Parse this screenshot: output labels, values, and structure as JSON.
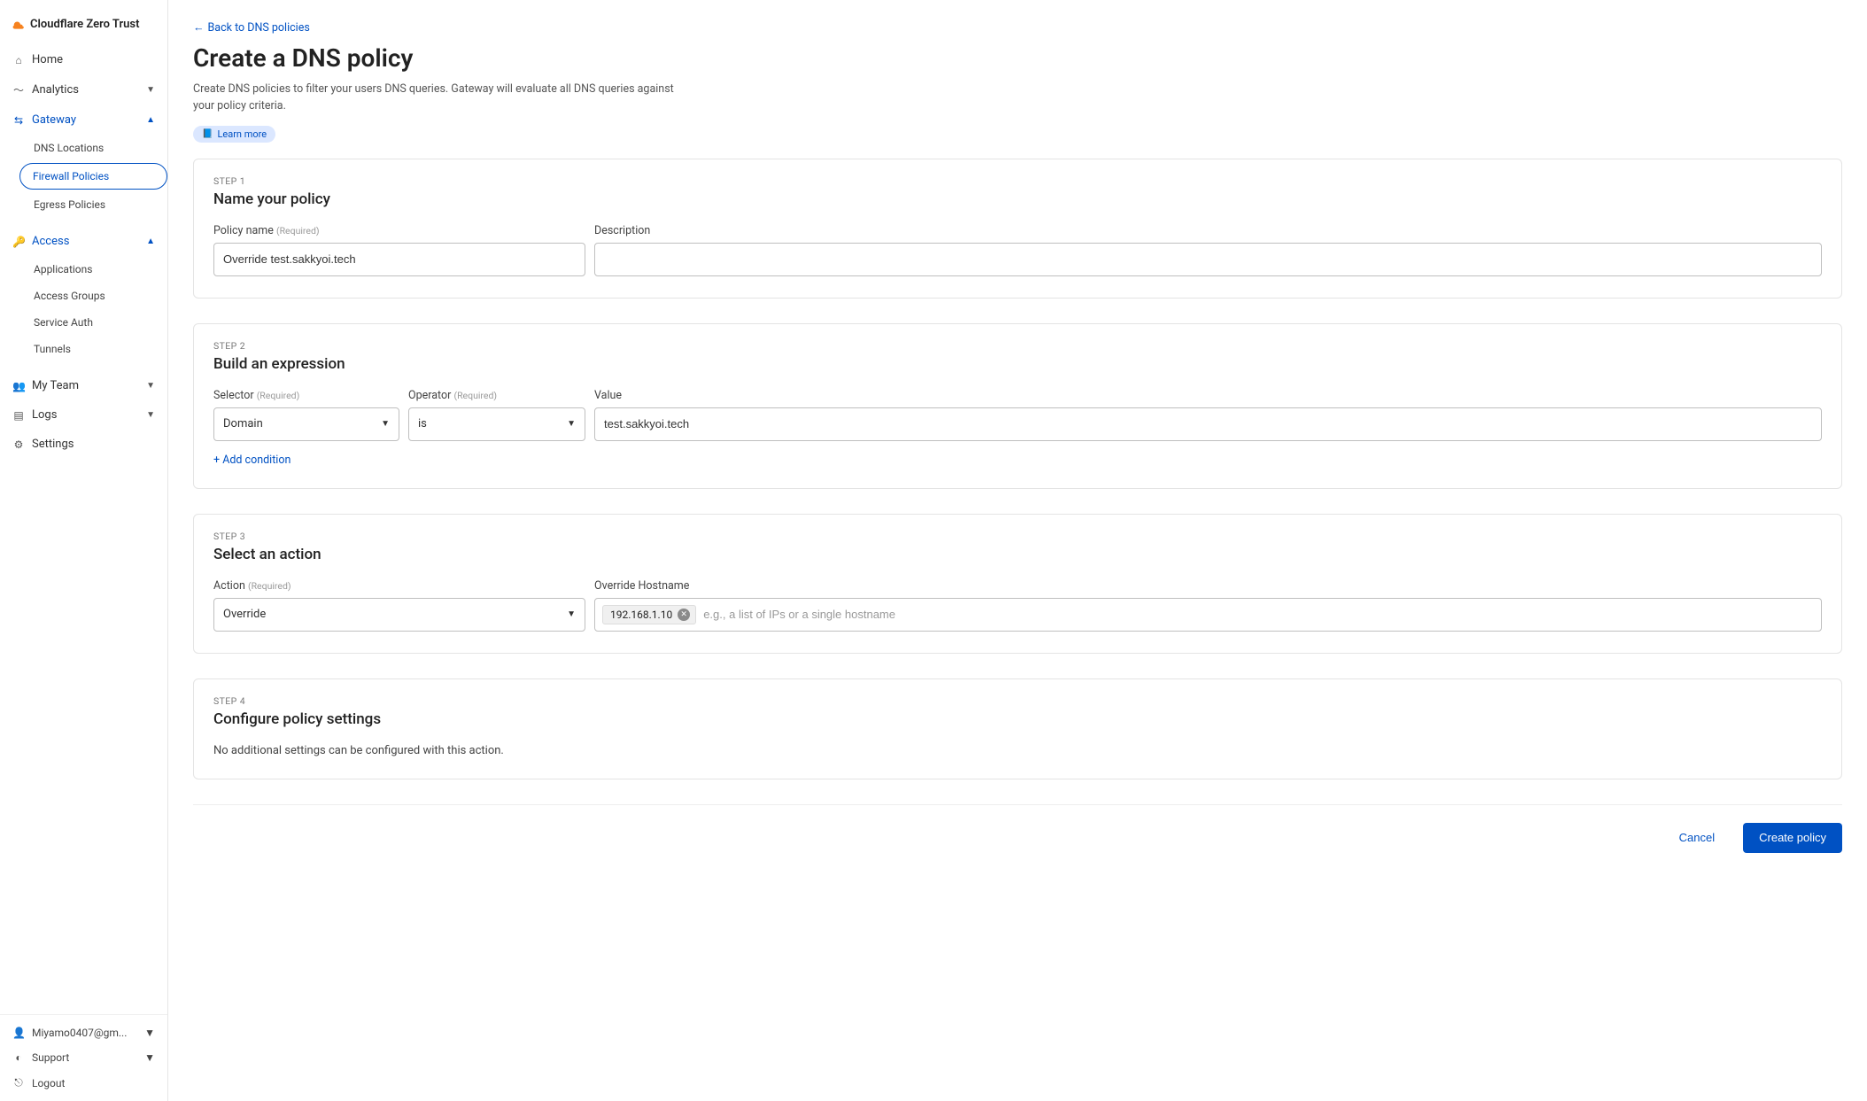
{
  "brand": {
    "title": "Cloudflare Zero Trust"
  },
  "sidebar": {
    "home": "Home",
    "analytics": "Analytics",
    "gateway": {
      "label": "Gateway",
      "dns_locations": "DNS Locations",
      "firewall_policies": "Firewall Policies",
      "egress_policies": "Egress Policies"
    },
    "access": {
      "label": "Access",
      "applications": "Applications",
      "access_groups": "Access Groups",
      "service_auth": "Service Auth",
      "tunnels": "Tunnels"
    },
    "my_team": "My Team",
    "logs": "Logs",
    "settings": "Settings"
  },
  "footer": {
    "account": "Miyamo0407@gm...",
    "support": "Support",
    "logout": "Logout"
  },
  "header": {
    "back_link": "Back to DNS policies",
    "title": "Create a DNS policy",
    "description": "Create DNS policies to filter your users DNS queries. Gateway will evaluate all DNS queries against your policy criteria.",
    "learn_more": "Learn more"
  },
  "step1": {
    "step_label": "STEP 1",
    "title": "Name your policy",
    "policy_name_label": "Policy name",
    "required": "(Required)",
    "policy_name_value": "Override test.sakkyoi.tech",
    "description_label": "Description",
    "description_value": ""
  },
  "step2": {
    "step_label": "STEP 2",
    "title": "Build an expression",
    "selector_label": "Selector",
    "operator_label": "Operator",
    "value_label": "Value",
    "required": "(Required)",
    "selector_value": "Domain",
    "operator_value": "is",
    "value_value": "test.sakkyoi.tech",
    "add_condition": "+ Add condition"
  },
  "step3": {
    "step_label": "STEP 3",
    "title": "Select an action",
    "action_label": "Action",
    "required": "(Required)",
    "action_value": "Override",
    "override_label": "Override Hostname",
    "override_tag": "192.168.1.10",
    "override_placeholder": "e.g., a list of IPs or a single hostname"
  },
  "step4": {
    "step_label": "STEP 4",
    "title": "Configure policy settings",
    "body": "No additional settings can be configured with this action."
  },
  "actions": {
    "cancel": "Cancel",
    "create": "Create policy"
  }
}
